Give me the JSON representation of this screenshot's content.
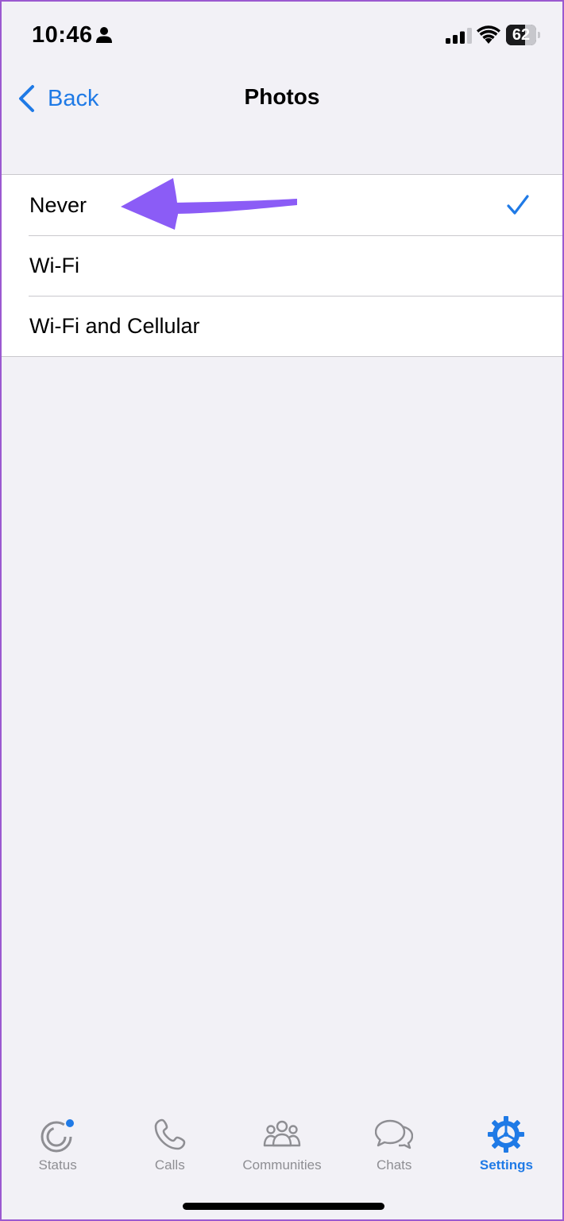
{
  "status_bar": {
    "time": "10:46",
    "battery_level": "62",
    "battery_fraction": 0.62
  },
  "nav": {
    "back_label": "Back",
    "title": "Photos"
  },
  "options": [
    {
      "label": "Never",
      "selected": true
    },
    {
      "label": "Wi-Fi",
      "selected": false
    },
    {
      "label": "Wi-Fi and Cellular",
      "selected": false
    }
  ],
  "tabs": [
    {
      "label": "Status",
      "icon": "status-icon",
      "active": false
    },
    {
      "label": "Calls",
      "icon": "phone-icon",
      "active": false
    },
    {
      "label": "Communities",
      "icon": "communities-icon",
      "active": false
    },
    {
      "label": "Chats",
      "icon": "chats-icon",
      "active": false
    },
    {
      "label": "Settings",
      "icon": "settings-gear-icon",
      "active": true
    }
  ],
  "colors": {
    "accent": "#1f7ae6",
    "background": "#f2f1f6",
    "inactive": "#8e8e93",
    "annotation": "#8b5cf6",
    "status_dot": "#1f7ae6"
  }
}
